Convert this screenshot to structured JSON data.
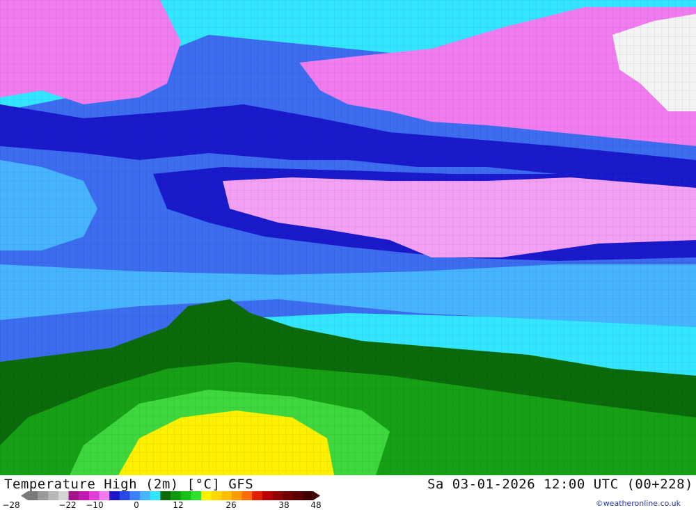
{
  "header": {
    "title": "Temperature High (2m) [°C] GFS",
    "datetime": "Sa 03-01-2026 12:00 UTC (00+228)",
    "credit": "©weatheronline.co.uk"
  },
  "legend": {
    "ticks": [
      "-28",
      "-22",
      "-10",
      "0",
      "12",
      "26",
      "38",
      "48"
    ],
    "colors": [
      "#7a7a7a",
      "#9a9a9a",
      "#b8b8b8",
      "#d4d4d4",
      "#a4138c",
      "#c41ab4",
      "#e03cd8",
      "#f07cf0",
      "#1a1acc",
      "#2a48e8",
      "#3c80ff",
      "#46b4ff",
      "#32e6ff",
      "#0b6b0b",
      "#109a10",
      "#16c016",
      "#2ee02e",
      "#fff000",
      "#ffd800",
      "#ffbe00",
      "#ff9a00",
      "#ff6c00",
      "#e02000",
      "#b80000",
      "#900000",
      "#700000",
      "#5a0000",
      "#400000"
    ]
  },
  "map": {
    "description_colors": {
      "magenta": "#f07cf0",
      "pink": "#f4a0f4",
      "navy": "#1a1acc",
      "blue": "#3c6cf0",
      "lightblue": "#46b4ff",
      "cyan": "#32e6ff",
      "darkgreen": "#0b6b0b",
      "green": "#16a016",
      "lightgreen": "#3ed83e",
      "yellow": "#fff000",
      "white": "#f4f4f4"
    }
  }
}
